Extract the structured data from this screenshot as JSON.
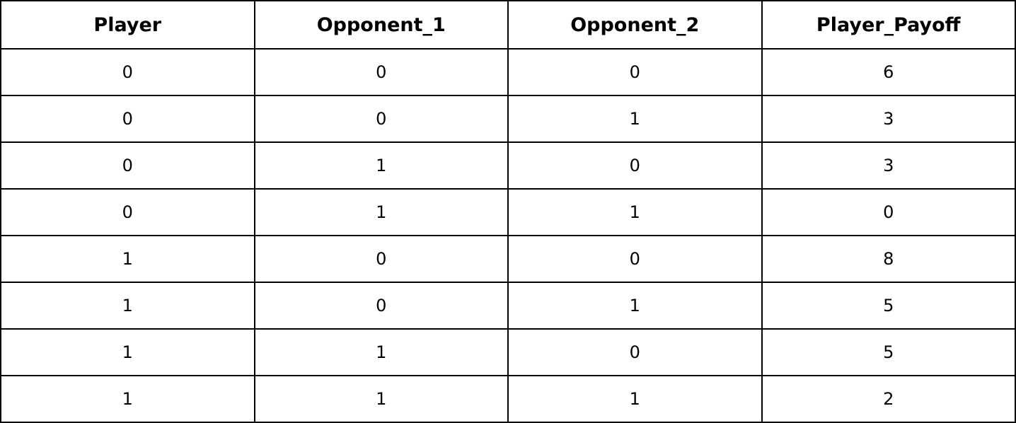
{
  "chart_data": {
    "type": "table",
    "columns": [
      "Player",
      "Opponent_1",
      "Opponent_2",
      "Player_Payoff"
    ],
    "rows": [
      [
        0,
        0,
        0,
        6
      ],
      [
        0,
        0,
        1,
        3
      ],
      [
        0,
        1,
        0,
        3
      ],
      [
        0,
        1,
        1,
        0
      ],
      [
        1,
        0,
        0,
        8
      ],
      [
        1,
        0,
        1,
        5
      ],
      [
        1,
        1,
        0,
        5
      ],
      [
        1,
        1,
        1,
        2
      ]
    ]
  },
  "colors": {
    "border": "#000000",
    "text": "#000000",
    "background": "#ffffff"
  }
}
